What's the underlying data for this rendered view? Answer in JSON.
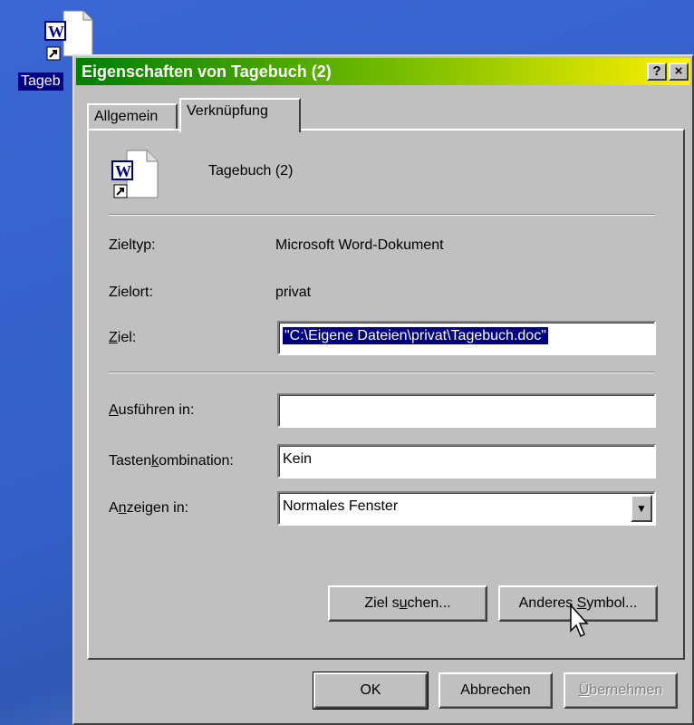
{
  "desktop": {
    "icon_label": "Tageb"
  },
  "dialog": {
    "title": "Eigenschaften von Tagebuch (2)",
    "help_button": "?",
    "close_button": "×",
    "tabs": [
      {
        "label": "Allgemein",
        "active": false
      },
      {
        "label": "Verknüpfung",
        "active": true
      }
    ],
    "shortcut_name": "Tagebuch (2)",
    "fields": {
      "zieltyp": {
        "label": "Zieltyp:",
        "value": "Microsoft Word-Dokument"
      },
      "zielort": {
        "label": "Zielort:",
        "value": "privat"
      },
      "ziel": {
        "label_pre": "",
        "label_ul": "Z",
        "label_post": "iel:",
        "value": "\"C:\\Eigene Dateien\\privat\\Tagebuch.doc\""
      },
      "ausfuehren": {
        "label_pre": "",
        "label_ul": "A",
        "label_post": "usführen in:",
        "value": ""
      },
      "tasten": {
        "label_pre": "Tasten",
        "label_ul": "k",
        "label_post": "ombination:",
        "value": "Kein"
      },
      "anzeigen": {
        "label_pre": "A",
        "label_ul": "n",
        "label_post": "zeigen in:",
        "value": "Normales Fenster"
      }
    },
    "buttons": {
      "ziel_suchen": {
        "pre": "Ziel s",
        "ul": "u",
        "post": "chen..."
      },
      "anderes_symbol": {
        "pre": "Anderes ",
        "ul": "S",
        "post": "ymbol..."
      },
      "ok": "OK",
      "abbrechen": "Abbrechen",
      "uebernehmen": {
        "pre": "",
        "ul": "Ü",
        "post": "bernehmen"
      }
    }
  },
  "colors": {
    "face": "#c0c0c0",
    "selection": "#000080",
    "title_start": "#008000",
    "title_end": "#fff000"
  }
}
